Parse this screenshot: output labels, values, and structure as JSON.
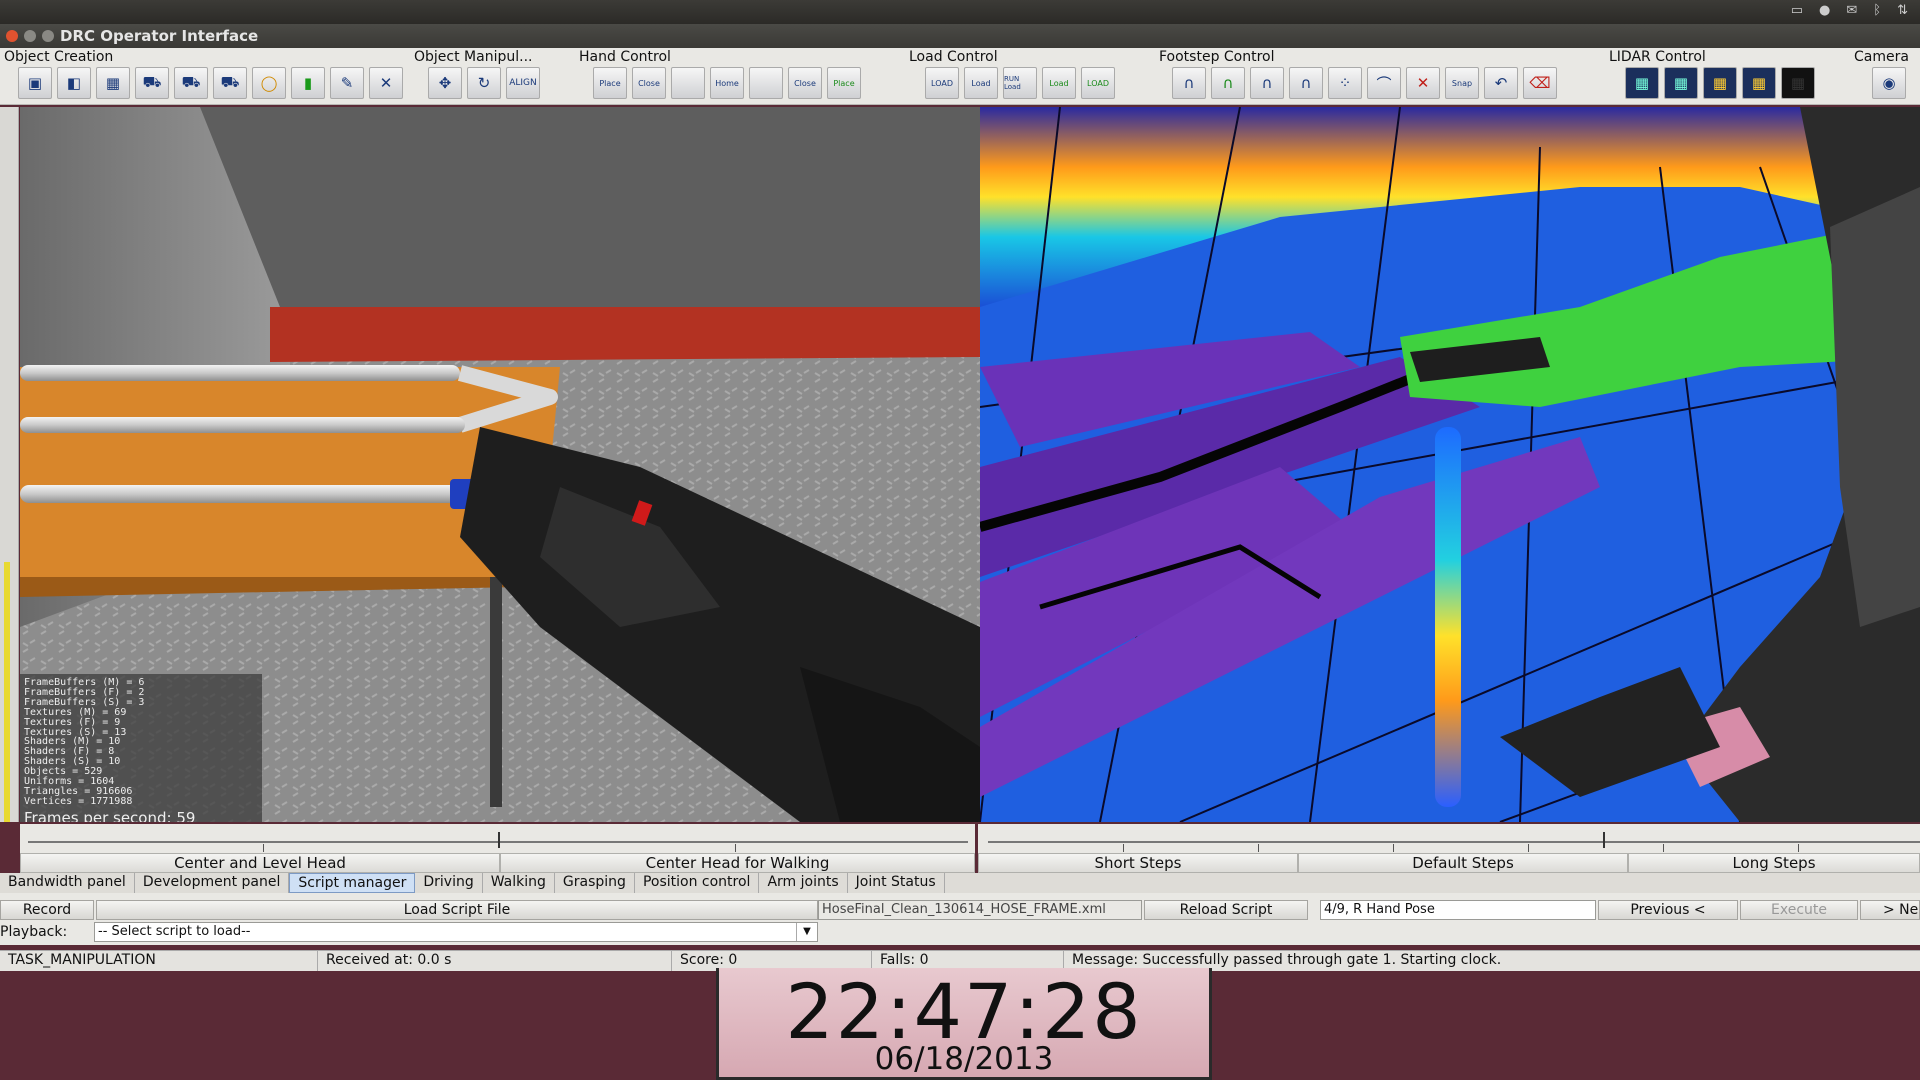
{
  "window": {
    "title": "DRC Operator Interface"
  },
  "toolbar": {
    "groups": [
      {
        "label": "Object Creation",
        "icons": [
          "cube-icon",
          "box-icon",
          "grid-icon",
          "car-icon",
          "vehicle-icon",
          "vehicle-alt-icon",
          "ring-icon",
          "pillar-icon",
          "tool-icon",
          "valve-icon"
        ]
      },
      {
        "label": "Object Manipul...",
        "icons": [
          "move-icon",
          "rotate-icon",
          "align-icon"
        ]
      },
      {
        "label": "Hand Control",
        "icons": [
          "hand-place-icon",
          "hand-close-icon",
          "hand-blank-icon",
          "hand-home-icon",
          "hand-blank2-icon",
          "hand-close2-icon",
          "hand-place2-icon"
        ]
      },
      {
        "label": "Load Control",
        "icons": [
          "load-icon",
          "load2-icon",
          "run-load-icon",
          "load3-icon",
          "load4-icon"
        ]
      },
      {
        "label": "Footstep Control",
        "icons": [
          "foot-icon",
          "foot2-icon",
          "foot3-icon",
          "foot4-icon",
          "scatter-icon",
          "path-icon",
          "cancel-icon",
          "snap-icon",
          "turn-icon",
          "delete-icon"
        ]
      },
      {
        "label": "LIDAR Control",
        "icons": [
          "lidar-icon",
          "lidar2-icon",
          "lidar3-icon",
          "lidar4-icon",
          "lidar5-icon"
        ]
      },
      {
        "label": "Camera",
        "icons": [
          "eye-icon"
        ]
      }
    ],
    "icon_labels": {
      "align": "ALIGN",
      "place": "Place",
      "close": "Close",
      "home": "Home",
      "load": "LOAD",
      "load_small": "Load",
      "run_load": "RUN Load",
      "snap": "Snap"
    }
  },
  "stats": {
    "lines": [
      "FrameBuffers (M) = 6",
      "FrameBuffers (F) = 2",
      "FrameBuffers (S) = 3",
      "Textures (M) = 69",
      "Textures (F) = 9",
      "Textures (S) = 13",
      "Shaders (M) = 10",
      "Shaders (F) = 8",
      "Shaders (S) = 10",
      "Objects = 529",
      "Uniforms = 1604",
      "Triangles = 916606",
      "Vertices = 1771988"
    ],
    "fps": "Frames per second: 59"
  },
  "head_slider": {
    "left_label": "Center and Level Head",
    "right_label": "Center Head for Walking",
    "value": 0.5
  },
  "step_slider": {
    "labels": [
      "Short Steps",
      "Default Steps",
      "Long Steps"
    ],
    "value": 0.66
  },
  "tabs": [
    {
      "label": "Bandwidth panel",
      "active": false
    },
    {
      "label": "Development panel",
      "active": false
    },
    {
      "label": "Script manager",
      "active": true
    },
    {
      "label": "Driving",
      "active": false
    },
    {
      "label": "Walking",
      "active": false
    },
    {
      "label": "Grasping",
      "active": false
    },
    {
      "label": "Position control",
      "active": false
    },
    {
      "label": "Arm joints",
      "active": false
    },
    {
      "label": "Joint Status",
      "active": false
    }
  ],
  "script": {
    "record_label": "Record",
    "load_label": "Load Script File",
    "file_name": "HoseFinal_Clean_130614_HOSE_FRAME.xml",
    "reload_label": "Reload Script",
    "step_text": "4/9, R Hand Pose",
    "previous_label": "Previous <",
    "execute_label": "Execute",
    "next_label": "> Ne",
    "playback_label": "Playback:",
    "select_value": "-- Select script to load--"
  },
  "status": {
    "task": "TASK_MANIPULATION",
    "received": "Received at:  0.0 s",
    "score": "Score:  0",
    "falls": "Falls:  0",
    "message": "Message:  Successfully passed through gate 1. Starting clock."
  },
  "clock": {
    "time": "22:47:28",
    "date": "06/18/2013"
  },
  "colors": {
    "accent": "#1f55d9",
    "active_tab": "#cfe0f5",
    "table_orange": "#d8862b",
    "pipe": "#d9d9d9",
    "robot_arm_green": "#3fd13f"
  }
}
